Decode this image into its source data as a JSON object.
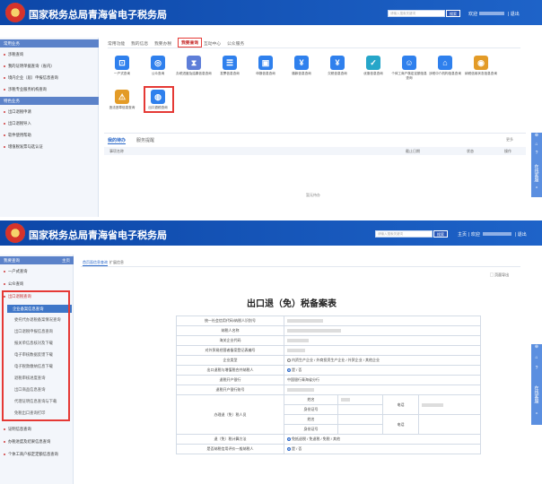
{
  "header": {
    "title": "国家税务总局青海省电子税务局",
    "search_placeholder": "请输入搜索关键词",
    "search_btn": "搜索",
    "welcome": "欢迎",
    "exit": "| 退出",
    "home": "主页",
    "welcome2": "| 欢迎",
    "exit2": "| 退出"
  },
  "top": {
    "sidebar_title": "常用业务",
    "sidebar_items": [
      "涉税查询",
      "我的证明单据查询（省内）",
      "境内企业（居）申报信息查询",
      "涉税专业服务机构查询"
    ],
    "sidebar_section": "特色业务",
    "sidebar_items2": [
      "出口退税申请",
      "出口退税导入",
      "软件使用帮助",
      "增值税发票勾选认证"
    ],
    "tabs": [
      "常用功能",
      "我的信息",
      "我要办税",
      "我要查询",
      "互动中心",
      "公众服务"
    ],
    "services": [
      {
        "label": "一户式查询",
        "color": "#2f80ed",
        "glyph": "⊡"
      },
      {
        "label": "公众查询",
        "color": "#2f80ed",
        "glyph": "◎"
      },
      {
        "label": "办税进度及结果信息查询",
        "color": "#5e7ed8",
        "glyph": "⧗"
      },
      {
        "label": "发票信息查询",
        "color": "#2f80ed",
        "glyph": "☰"
      },
      {
        "label": "申报信息查询",
        "color": "#2f80ed",
        "glyph": "▣"
      },
      {
        "label": "缴款信息查询",
        "color": "#2f80ed",
        "glyph": "¥"
      },
      {
        "label": "欠税信息查询",
        "color": "#2f80ed",
        "glyph": "¥"
      },
      {
        "label": "优惠信息查询",
        "color": "#26a6c9",
        "glyph": "✓"
      },
      {
        "label": "个体工商户核定定额信息查询",
        "color": "#2f80ed",
        "glyph": "☺"
      },
      {
        "label": "涉税中介机构信息查询",
        "color": "#2f80ed",
        "glyph": "⌂"
      },
      {
        "label": "纳税信用状态信息查询",
        "color": "#e39b27",
        "glyph": "◉"
      }
    ],
    "services2": [
      {
        "label": "违法违章信息查询",
        "color": "#e39b27",
        "glyph": "⚠"
      },
      {
        "label": "出口退税查询",
        "color": "#2f80ed",
        "glyph": "◍"
      }
    ],
    "todo_tabs": [
      "我的待办",
      "服务提醒"
    ],
    "todo_more": "更多",
    "cols": [
      "事项名称",
      "截止日期",
      "状态",
      "操作"
    ],
    "empty": "暂无待办",
    "float": [
      "⊕",
      "⌂",
      "?",
      "在线客服",
      "^"
    ]
  },
  "bottom": {
    "sidebar_title": "我要查询",
    "sidebar_home": "主页",
    "groups": [
      "一户式查询",
      "公众查询"
    ],
    "active_group": "出口退税查询",
    "sub_items": [
      "企业备案信息查询",
      "委托代办退税备案情况查询",
      "出口退税申报信息查询",
      "报关单信息核对及下载",
      "电子审核数据反馈下载",
      "电子税款缴纳信息下载",
      "退税审核进度查询",
      "出口商品信息查询",
      "代理证明信息查询与下载",
      "免税出口查询打印"
    ],
    "other_groups": [
      "证明信息查询",
      "办税进度及结果信息查询",
      "个体工商户核定定额信息查询"
    ],
    "tabs": [
      "首页面信息查询",
      "扩展信息"
    ],
    "print": "▢ 页面导出",
    "form_title": "出口退（免）税备案表",
    "rows": [
      {
        "label": "统一社会信用代码/纳税人识别号",
        "value": ""
      },
      {
        "label": "纳税人名称",
        "value": ""
      },
      {
        "label": "海关企业代码",
        "value": ""
      },
      {
        "label": "对外贸易经营者备案登记表编号",
        "value": ""
      },
      {
        "label": "企业类型",
        "value": "内资生产企业 / 外商投资生产企业 / 外贸企业 / 其他企业"
      },
      {
        "label": "出口退税与增值税合并纳税人",
        "value": "是 / 否"
      },
      {
        "label": "退税开户银行",
        "value": "中国银行青海省分行"
      },
      {
        "label": "退税开户银行账号",
        "value": ""
      },
      {
        "label": "办理退（免）税人员",
        "value": ""
      },
      {
        "label": "退（免）税计算方法",
        "value": "免抵退税 / 免退税 / 免税 / 其他"
      },
      {
        "label": "是否纳税信用评价一般纳税人",
        "value": "是 / 否"
      }
    ],
    "person_fields": [
      "姓名",
      "身份证号",
      "电话"
    ],
    "float": [
      "⊕",
      "⌂",
      "?",
      "在线客服",
      "^"
    ]
  }
}
